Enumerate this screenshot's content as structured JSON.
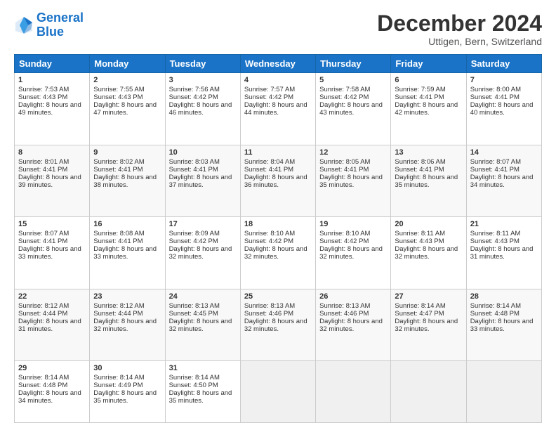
{
  "logo": {
    "line1": "General",
    "line2": "Blue"
  },
  "title": "December 2024",
  "subtitle": "Uttigen, Bern, Switzerland",
  "days_of_week": [
    "Sunday",
    "Monday",
    "Tuesday",
    "Wednesday",
    "Thursday",
    "Friday",
    "Saturday"
  ],
  "weeks": [
    [
      {
        "day": "1",
        "sunrise": "Sunrise: 7:53 AM",
        "sunset": "Sunset: 4:43 PM",
        "daylight": "Daylight: 8 hours and 49 minutes."
      },
      {
        "day": "2",
        "sunrise": "Sunrise: 7:55 AM",
        "sunset": "Sunset: 4:43 PM",
        "daylight": "Daylight: 8 hours and 47 minutes."
      },
      {
        "day": "3",
        "sunrise": "Sunrise: 7:56 AM",
        "sunset": "Sunset: 4:42 PM",
        "daylight": "Daylight: 8 hours and 46 minutes."
      },
      {
        "day": "4",
        "sunrise": "Sunrise: 7:57 AM",
        "sunset": "Sunset: 4:42 PM",
        "daylight": "Daylight: 8 hours and 44 minutes."
      },
      {
        "day": "5",
        "sunrise": "Sunrise: 7:58 AM",
        "sunset": "Sunset: 4:42 PM",
        "daylight": "Daylight: 8 hours and 43 minutes."
      },
      {
        "day": "6",
        "sunrise": "Sunrise: 7:59 AM",
        "sunset": "Sunset: 4:41 PM",
        "daylight": "Daylight: 8 hours and 42 minutes."
      },
      {
        "day": "7",
        "sunrise": "Sunrise: 8:00 AM",
        "sunset": "Sunset: 4:41 PM",
        "daylight": "Daylight: 8 hours and 40 minutes."
      }
    ],
    [
      {
        "day": "8",
        "sunrise": "Sunrise: 8:01 AM",
        "sunset": "Sunset: 4:41 PM",
        "daylight": "Daylight: 8 hours and 39 minutes."
      },
      {
        "day": "9",
        "sunrise": "Sunrise: 8:02 AM",
        "sunset": "Sunset: 4:41 PM",
        "daylight": "Daylight: 8 hours and 38 minutes."
      },
      {
        "day": "10",
        "sunrise": "Sunrise: 8:03 AM",
        "sunset": "Sunset: 4:41 PM",
        "daylight": "Daylight: 8 hours and 37 minutes."
      },
      {
        "day": "11",
        "sunrise": "Sunrise: 8:04 AM",
        "sunset": "Sunset: 4:41 PM",
        "daylight": "Daylight: 8 hours and 36 minutes."
      },
      {
        "day": "12",
        "sunrise": "Sunrise: 8:05 AM",
        "sunset": "Sunset: 4:41 PM",
        "daylight": "Daylight: 8 hours and 35 minutes."
      },
      {
        "day": "13",
        "sunrise": "Sunrise: 8:06 AM",
        "sunset": "Sunset: 4:41 PM",
        "daylight": "Daylight: 8 hours and 35 minutes."
      },
      {
        "day": "14",
        "sunrise": "Sunrise: 8:07 AM",
        "sunset": "Sunset: 4:41 PM",
        "daylight": "Daylight: 8 hours and 34 minutes."
      }
    ],
    [
      {
        "day": "15",
        "sunrise": "Sunrise: 8:07 AM",
        "sunset": "Sunset: 4:41 PM",
        "daylight": "Daylight: 8 hours and 33 minutes."
      },
      {
        "day": "16",
        "sunrise": "Sunrise: 8:08 AM",
        "sunset": "Sunset: 4:41 PM",
        "daylight": "Daylight: 8 hours and 33 minutes."
      },
      {
        "day": "17",
        "sunrise": "Sunrise: 8:09 AM",
        "sunset": "Sunset: 4:42 PM",
        "daylight": "Daylight: 8 hours and 32 minutes."
      },
      {
        "day": "18",
        "sunrise": "Sunrise: 8:10 AM",
        "sunset": "Sunset: 4:42 PM",
        "daylight": "Daylight: 8 hours and 32 minutes."
      },
      {
        "day": "19",
        "sunrise": "Sunrise: 8:10 AM",
        "sunset": "Sunset: 4:42 PM",
        "daylight": "Daylight: 8 hours and 32 minutes."
      },
      {
        "day": "20",
        "sunrise": "Sunrise: 8:11 AM",
        "sunset": "Sunset: 4:43 PM",
        "daylight": "Daylight: 8 hours and 32 minutes."
      },
      {
        "day": "21",
        "sunrise": "Sunrise: 8:11 AM",
        "sunset": "Sunset: 4:43 PM",
        "daylight": "Daylight: 8 hours and 31 minutes."
      }
    ],
    [
      {
        "day": "22",
        "sunrise": "Sunrise: 8:12 AM",
        "sunset": "Sunset: 4:44 PM",
        "daylight": "Daylight: 8 hours and 31 minutes."
      },
      {
        "day": "23",
        "sunrise": "Sunrise: 8:12 AM",
        "sunset": "Sunset: 4:44 PM",
        "daylight": "Daylight: 8 hours and 32 minutes."
      },
      {
        "day": "24",
        "sunrise": "Sunrise: 8:13 AM",
        "sunset": "Sunset: 4:45 PM",
        "daylight": "Daylight: 8 hours and 32 minutes."
      },
      {
        "day": "25",
        "sunrise": "Sunrise: 8:13 AM",
        "sunset": "Sunset: 4:46 PM",
        "daylight": "Daylight: 8 hours and 32 minutes."
      },
      {
        "day": "26",
        "sunrise": "Sunrise: 8:13 AM",
        "sunset": "Sunset: 4:46 PM",
        "daylight": "Daylight: 8 hours and 32 minutes."
      },
      {
        "day": "27",
        "sunrise": "Sunrise: 8:14 AM",
        "sunset": "Sunset: 4:47 PM",
        "daylight": "Daylight: 8 hours and 32 minutes."
      },
      {
        "day": "28",
        "sunrise": "Sunrise: 8:14 AM",
        "sunset": "Sunset: 4:48 PM",
        "daylight": "Daylight: 8 hours and 33 minutes."
      }
    ],
    [
      {
        "day": "29",
        "sunrise": "Sunrise: 8:14 AM",
        "sunset": "Sunset: 4:48 PM",
        "daylight": "Daylight: 8 hours and 34 minutes."
      },
      {
        "day": "30",
        "sunrise": "Sunrise: 8:14 AM",
        "sunset": "Sunset: 4:49 PM",
        "daylight": "Daylight: 8 hours and 35 minutes."
      },
      {
        "day": "31",
        "sunrise": "Sunrise: 8:14 AM",
        "sunset": "Sunset: 4:50 PM",
        "daylight": "Daylight: 8 hours and 35 minutes."
      },
      null,
      null,
      null,
      null
    ]
  ]
}
